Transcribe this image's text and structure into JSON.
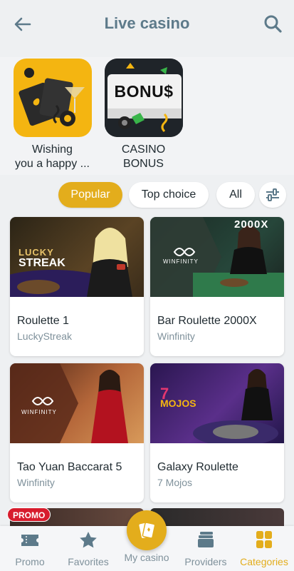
{
  "header": {
    "title": "Live casino",
    "back_icon": "arrow-left-icon",
    "search_icon": "search-icon"
  },
  "promos": [
    {
      "label_line1": "Wishing",
      "label_line2": "you a happy ...",
      "bg": "#f4b511"
    },
    {
      "label_line1": "CASINO",
      "label_line2": "BONUS",
      "art_text": "BONU$",
      "bg": "#1f2429"
    }
  ],
  "chips": [
    {
      "label": "Popular",
      "active": true
    },
    {
      "label": "Top choice",
      "active": false
    },
    {
      "label": "All",
      "active": false
    },
    {
      "icon": "filter-sliders-icon"
    }
  ],
  "games": [
    {
      "name": "Roulette 1",
      "provider": "LuckyStreak",
      "art_text_1": "LUCKY",
      "art_text_2": "STREAK"
    },
    {
      "name": "Bar Roulette 2000X",
      "provider": "Winfinity",
      "art_text_1": "2000X",
      "art_text_2": "WINFINITY"
    },
    {
      "name": "Tao Yuan Baccarat 5",
      "provider": "Winfinity",
      "art_text_1": "WINFINITY"
    },
    {
      "name": "Galaxy Roulette",
      "provider": "7 Mojos",
      "art_text_1": "MOJOS"
    }
  ],
  "badge": {
    "label": "PROMO"
  },
  "nav": [
    {
      "label": "Promo",
      "icon": "ticket-icon",
      "active": false
    },
    {
      "label": "Favorites",
      "icon": "star-icon",
      "active": false
    },
    {
      "label": "My casino",
      "icon": "playing-cards-icon",
      "active": false
    },
    {
      "label": "Providers",
      "icon": "stacked-cards-icon",
      "active": false
    },
    {
      "label": "Categories",
      "icon": "grid-squares-icon",
      "active": true
    }
  ],
  "colors": {
    "accent": "#e3ad1c",
    "title": "#5d7a8a",
    "muted": "#7f919b"
  }
}
